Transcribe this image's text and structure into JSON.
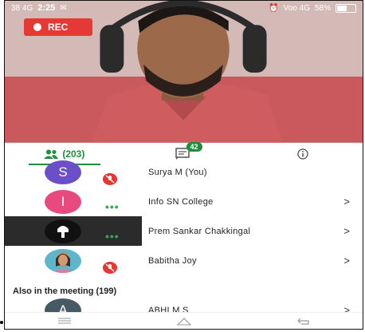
{
  "status_bar": {
    "time": "2:25",
    "left_indicators": "38 4G",
    "right_indicators": "Voo 4G",
    "battery_percent": "58%",
    "battery_level": 0.58
  },
  "recording": {
    "label": "REC"
  },
  "tabs": {
    "people_count": "(203)",
    "chat_count": "42"
  },
  "participants": [
    {
      "initial": "S",
      "name": "Surya M (You)",
      "avatar_color": "#6a4fc9",
      "status": "muted"
    },
    {
      "initial": "I",
      "name": "Info SN College",
      "avatar_color": "#e84a7f",
      "status": "speaking"
    },
    {
      "initial": "",
      "name": "Prem Sankar Chakkingal",
      "avatar_color": "#111111",
      "status": "speaking"
    },
    {
      "initial": "",
      "name": "Babitha Joy",
      "avatar_color": "#8a5a3c",
      "status": "muted"
    }
  ],
  "section_title": "Also in the meeting (199)",
  "also_participants": [
    {
      "initial": "A",
      "name": "ABHI M S",
      "avatar_color": "#455a64"
    }
  ],
  "colors": {
    "accent": "#1e8e3e",
    "rec": "#e53935"
  }
}
